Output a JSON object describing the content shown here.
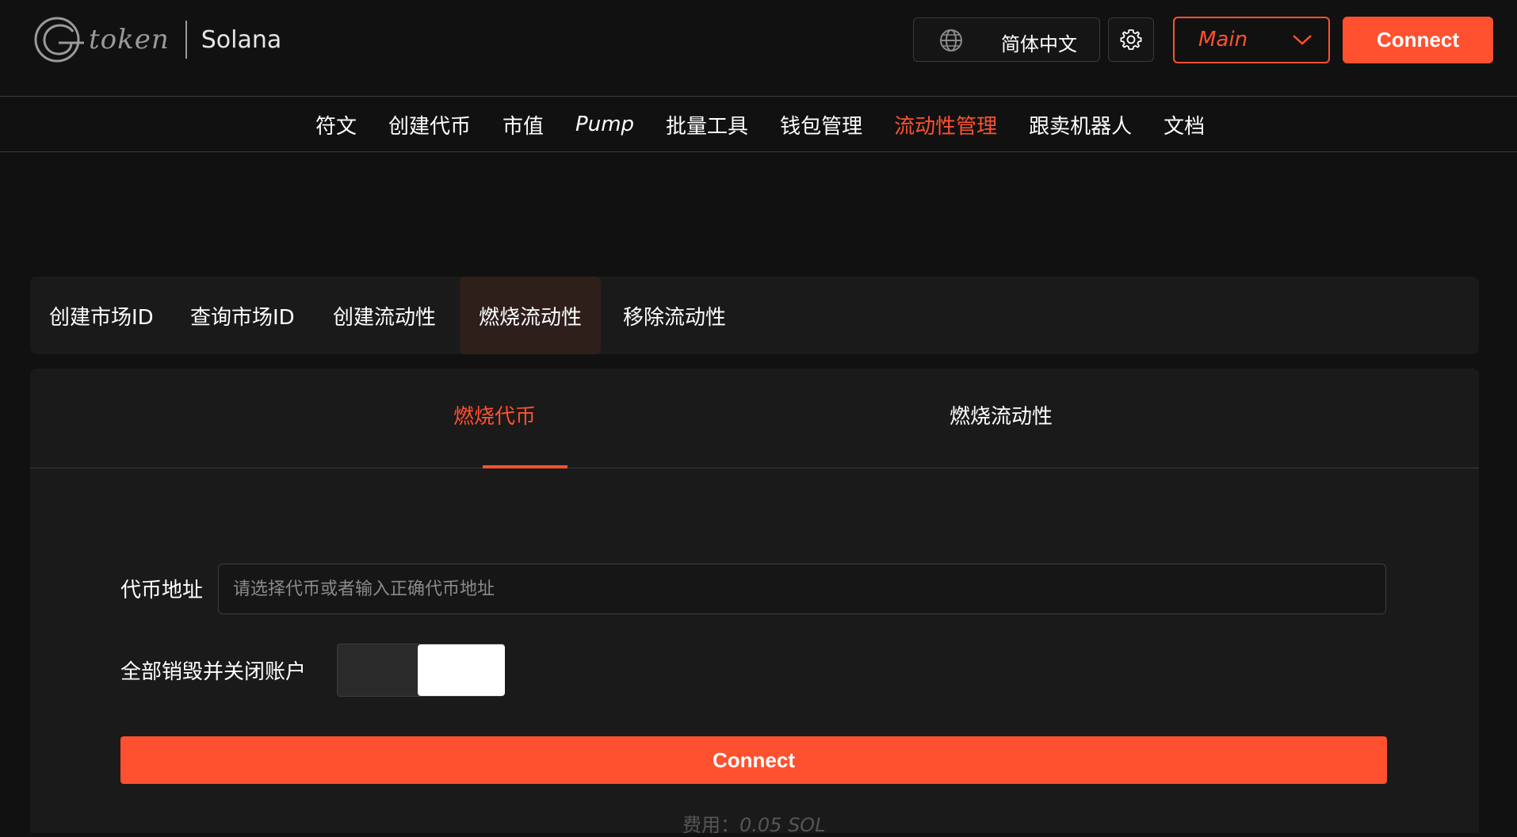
{
  "header": {
    "logo_text": "token",
    "chain_label": "Solana",
    "language_label": "简体中文",
    "network_label": "Main",
    "connect_label": "Connect"
  },
  "nav": {
    "items": [
      {
        "label": "符文"
      },
      {
        "label": "创建代币"
      },
      {
        "label": "市值"
      },
      {
        "label": "Pump"
      },
      {
        "label": "批量工具"
      },
      {
        "label": "钱包管理"
      },
      {
        "label": "流动性管理"
      },
      {
        "label": "跟卖机器人"
      },
      {
        "label": "文档"
      }
    ],
    "active_index": 6
  },
  "tabs": {
    "items": [
      {
        "label": "创建市场ID"
      },
      {
        "label": "查询市场ID"
      },
      {
        "label": "创建流动性"
      },
      {
        "label": "燃烧流动性"
      },
      {
        "label": "移除流动性"
      }
    ],
    "active_index": 3
  },
  "subtabs": {
    "items": [
      {
        "label": "燃烧代币"
      },
      {
        "label": "燃烧流动性"
      }
    ],
    "active_index": 0
  },
  "form": {
    "address_label": "代币地址",
    "address_placeholder": "请选择代币或者输入正确代币地址",
    "address_value": "",
    "close_account_label": "全部销毁并关闭账户",
    "close_account_enabled": true,
    "connect_label": "Connect",
    "fee_label": "费用：",
    "fee_value": "0.05 SOL"
  },
  "colors": {
    "accent": "#ff512f",
    "background": "#111111",
    "card": "#1a1a1a",
    "active_tab": "#2e1f1b"
  }
}
